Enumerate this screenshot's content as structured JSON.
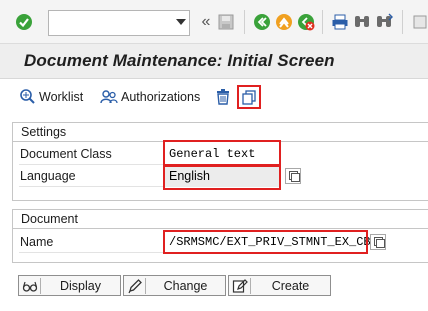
{
  "toolbar": {
    "icons": [
      "enter-icon",
      "back-icon",
      "save-icon",
      "back-nav-icon",
      "exit-icon",
      "cancel-icon",
      "print-icon",
      "find-icon",
      "find-next-icon"
    ],
    "command_field_value": "",
    "overflow_glyph": "«"
  },
  "screen": {
    "title": "Document Maintenance: Initial Screen"
  },
  "app_toolbar": {
    "worklist_label": "Worklist",
    "authorizations_label": "Authorizations"
  },
  "settings": {
    "group_title": "Settings",
    "document_class_label": "Document Class",
    "document_class_value": "General text",
    "language_label": "Language",
    "language_value": "English"
  },
  "document": {
    "group_title": "Document",
    "name_label": "Name",
    "name_value": "/SRMSMC/EXT_PRIV_STMNT_EX_CB"
  },
  "buttons": {
    "display_label": "Display",
    "change_label": "Change",
    "create_label": "Create"
  },
  "colors": {
    "highlight_border": "#e02020",
    "ok_green": "#3aa23a",
    "title_band": "#eeeeee"
  }
}
